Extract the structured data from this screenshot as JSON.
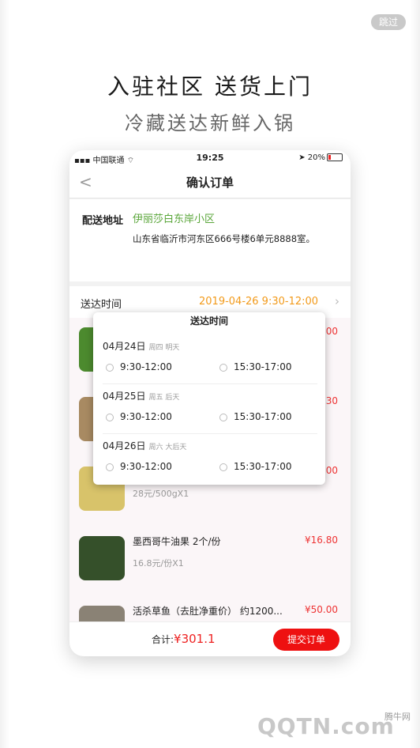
{
  "splash": {
    "skip_label": "跳过",
    "headline": "入驻社区   送货上门",
    "subheadline": "冷藏送达新鲜入锅"
  },
  "status_bar": {
    "carrier": "中国联通",
    "time": "19:25",
    "battery": "20%",
    "battery_level": 0.2
  },
  "nav": {
    "title": "确认订单"
  },
  "address": {
    "label": "配送地址",
    "name": "伊丽莎白东岸小区",
    "detail": "山东省临沂市河东区666号楼6单元8888室。"
  },
  "delivery": {
    "label": "送达时间",
    "value": "2019-04-26 9:30-12:00"
  },
  "items": [
    {
      "name": "",
      "price": "00",
      "sub": ""
    },
    {
      "name": "",
      "price": "30",
      "sub": ""
    },
    {
      "name": "",
      "price": "00",
      "sub": "28元/500gX1"
    },
    {
      "name": "墨西哥牛油果   2个/份",
      "price": "¥16.80",
      "sub": "16.8元/份X1"
    },
    {
      "name": "活杀草鱼（去肚净重价）   约1200...",
      "price": "¥50.00",
      "sub": ""
    }
  ],
  "popup": {
    "title": "送达时间",
    "days": [
      {
        "date": "04月24日",
        "note": "周四 明天",
        "slots": [
          "9:30-12:00",
          "15:30-17:00"
        ]
      },
      {
        "date": "04月25日",
        "note": "周五 后天",
        "slots": [
          "9:30-12:00",
          "15:30-17:00"
        ]
      },
      {
        "date": "04月26日",
        "note": "周六 大后天",
        "slots": [
          "9:30-12:00",
          "15:30-17:00"
        ]
      }
    ]
  },
  "footer": {
    "total_label": "合计:",
    "total_value": "¥301.1",
    "submit_label": "提交订单"
  },
  "watermark": {
    "text": "QQTN.com",
    "cn": "腾牛网"
  }
}
